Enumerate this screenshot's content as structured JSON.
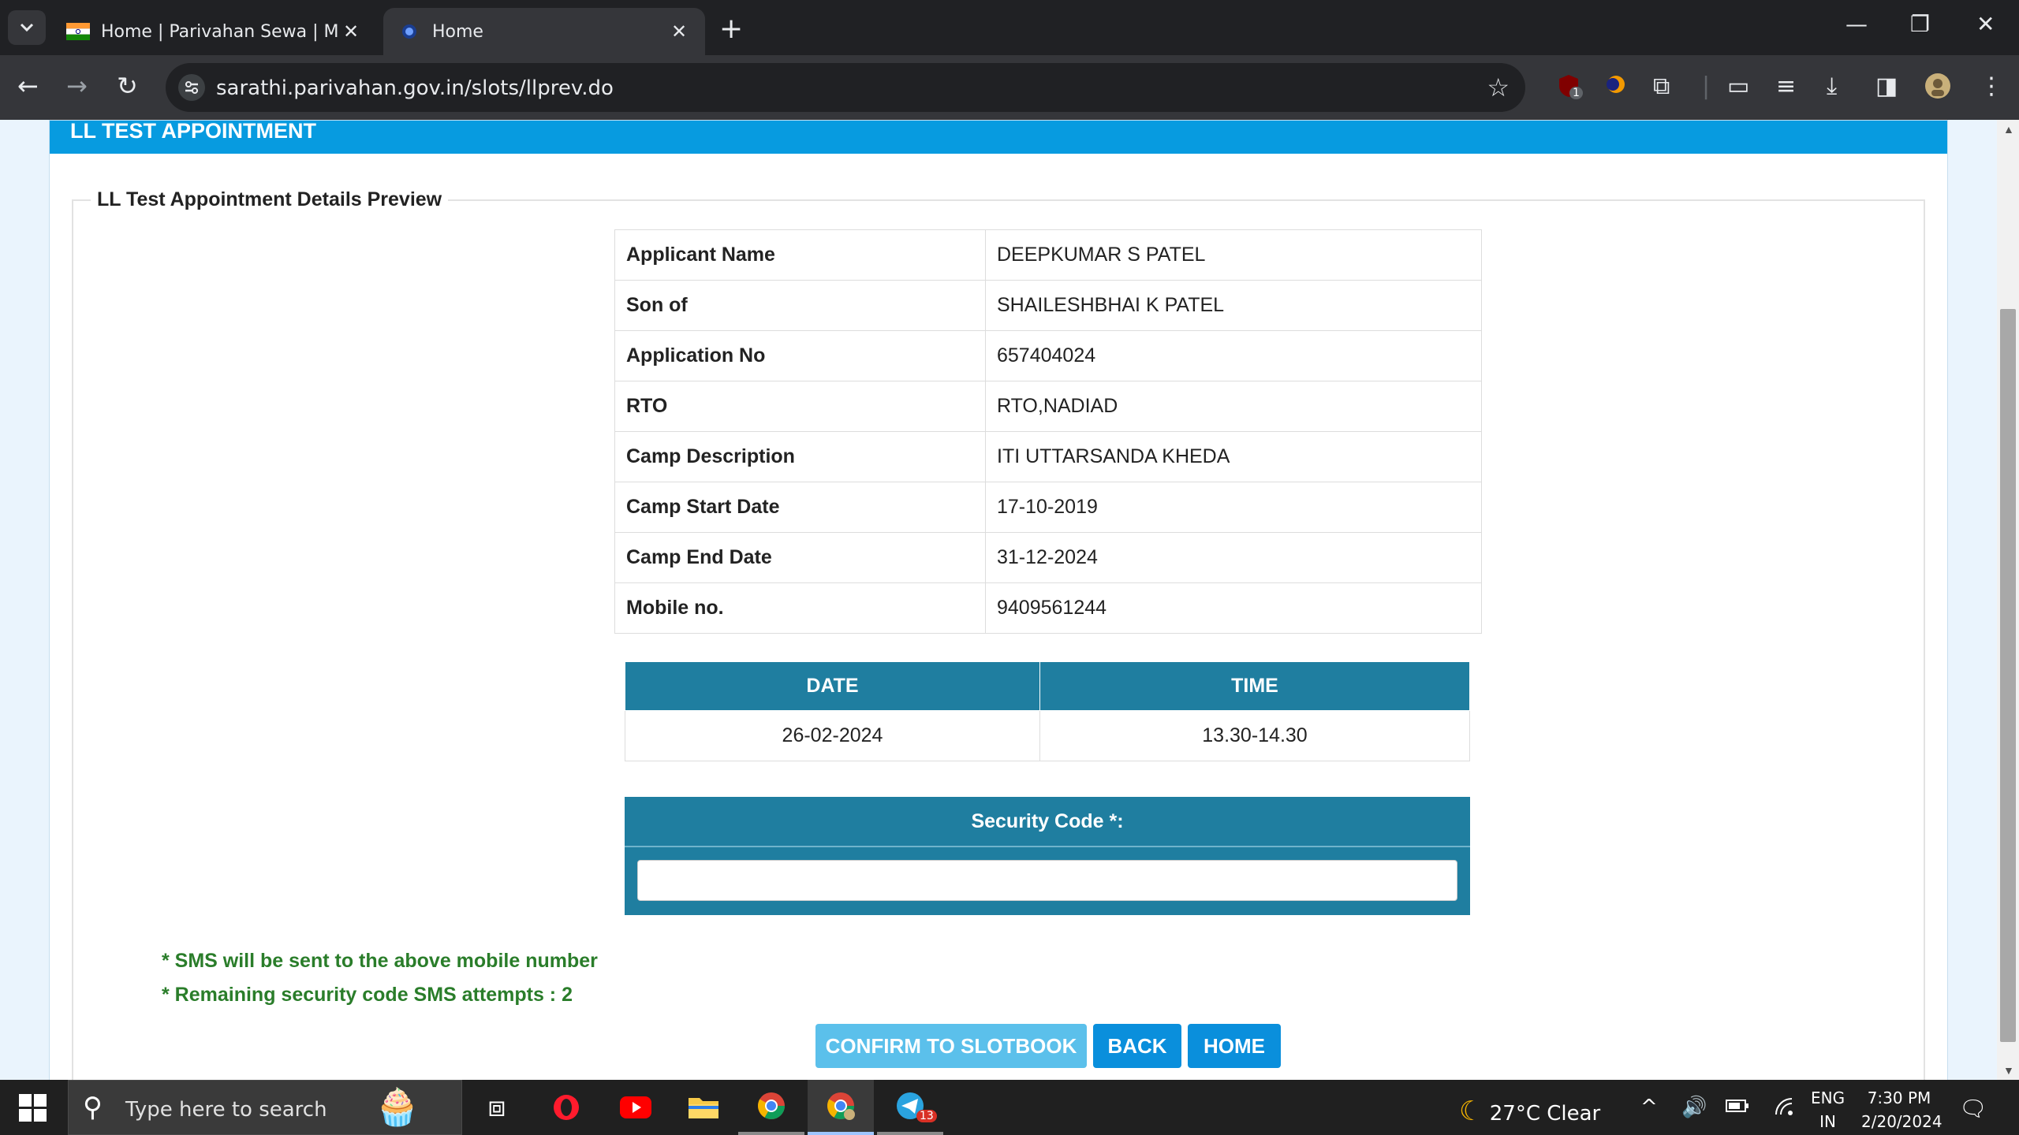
{
  "browser": {
    "tabs": [
      {
        "title": "Home | Parivahan Sewa | Minist",
        "active": false
      },
      {
        "title": "Home",
        "active": true
      }
    ],
    "url": "sarathi.parivahan.gov.in/slots/llprev.do",
    "extension_badge": "1"
  },
  "page": {
    "header": "LL TEST APPOINTMENT",
    "section_title": "LL Test Appointment Details Preview",
    "details": [
      {
        "label": "Applicant Name",
        "value": "DEEPKUMAR S PATEL"
      },
      {
        "label": "Son of",
        "value": "SHAILESHBHAI K PATEL"
      },
      {
        "label": "Application No",
        "value": "657404024"
      },
      {
        "label": "RTO",
        "value": "RTO,NADIAD"
      },
      {
        "label": "Camp Description",
        "value": "ITI UTTARSANDA KHEDA"
      },
      {
        "label": "Camp Start Date",
        "value": "17-10-2019"
      },
      {
        "label": "Camp End Date",
        "value": "31-12-2024"
      },
      {
        "label": "Mobile no.",
        "value": "9409561244"
      }
    ],
    "slot": {
      "date_header": "DATE",
      "time_header": "TIME",
      "date": "26-02-2024",
      "time": "13.30-14.30"
    },
    "security": {
      "label": "Security Code *:",
      "value": ""
    },
    "notes": [
      "* SMS will be sent to the above mobile number",
      "* Remaining security code SMS attempts : 2"
    ],
    "buttons": {
      "confirm": "CONFIRM TO SLOTBOOK",
      "back": "BACK",
      "home": "HOME"
    }
  },
  "taskbar": {
    "search_placeholder": "Type here to search",
    "telegram_badge": "13",
    "weather": "27°C  Clear",
    "lang_top": "ENG",
    "lang_bottom": "IN",
    "time": "7:30 PM",
    "date": "2/20/2024"
  },
  "colors": {
    "header_blue": "#079be0",
    "table_header": "#1f7ea0",
    "note_green": "#2a7d2a",
    "confirm_button": "#5bc0eb",
    "nav_button": "#0a8fdc"
  }
}
